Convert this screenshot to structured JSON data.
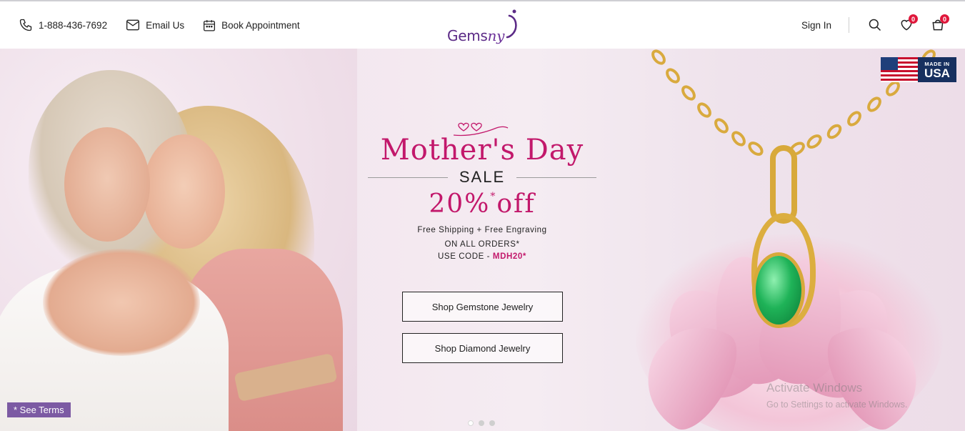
{
  "header": {
    "phone": "1-888-436-7692",
    "email_label": "Email Us",
    "appointment_label": "Book Appointment",
    "logo_text_a": "Gems",
    "logo_text_b": "ny",
    "signin_label": "Sign In",
    "wishlist_count": "0",
    "cart_count": "0"
  },
  "hero": {
    "title": "Mother's Day",
    "sale": "SALE",
    "discount_main": "20%",
    "discount_star": "*",
    "discount_suffix": "off",
    "free_text": "Free Shipping + Free Engraving",
    "orders_text": "ON ALL ORDERS*",
    "code_prefix": "USE CODE - ",
    "code_value": "MDH20*",
    "btn_gemstone": "Shop Gemstone Jewelry",
    "btn_diamond": "Shop Diamond Jewelry",
    "see_terms": "* See Terms",
    "badge_made_in": "MADE IN",
    "badge_usa": "USA"
  },
  "carousel": {
    "slides": 3,
    "active": 1
  },
  "overlay": {
    "activate_title": "Activate Windows",
    "activate_sub": "Go to Settings to activate Windows."
  },
  "colors": {
    "brand_purple": "#5b2a86",
    "accent_pink": "#c2186b",
    "badge_red": "#e0173b",
    "terms_purple": "#7c5aa3"
  },
  "icons": [
    "phone-icon",
    "mail-icon",
    "calendar-icon",
    "search-icon",
    "heart-icon",
    "cart-icon"
  ]
}
